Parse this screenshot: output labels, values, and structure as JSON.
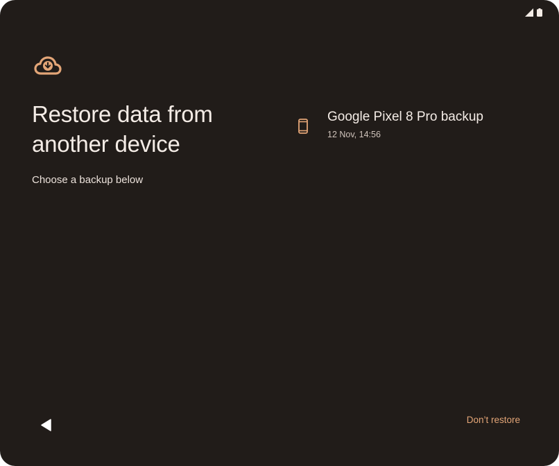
{
  "colors": {
    "background": "#211c19",
    "accent": "#e3a577",
    "text_primary": "#f4ece6",
    "text_secondary": "#cfc3bb"
  },
  "status_bar": {
    "icons": [
      "signal-icon",
      "battery-icon"
    ]
  },
  "header": {
    "icon": "cloud-download-icon",
    "title": "Restore data from another device",
    "subtitle": "Choose a backup below"
  },
  "backups": [
    {
      "icon": "smartphone-icon",
      "name": "Google Pixel 8 Pro backup",
      "date": "12 Nov, 14:56"
    }
  ],
  "footer": {
    "back_icon": "back-triangle-icon",
    "dont_restore_label": "Don’t restore"
  }
}
